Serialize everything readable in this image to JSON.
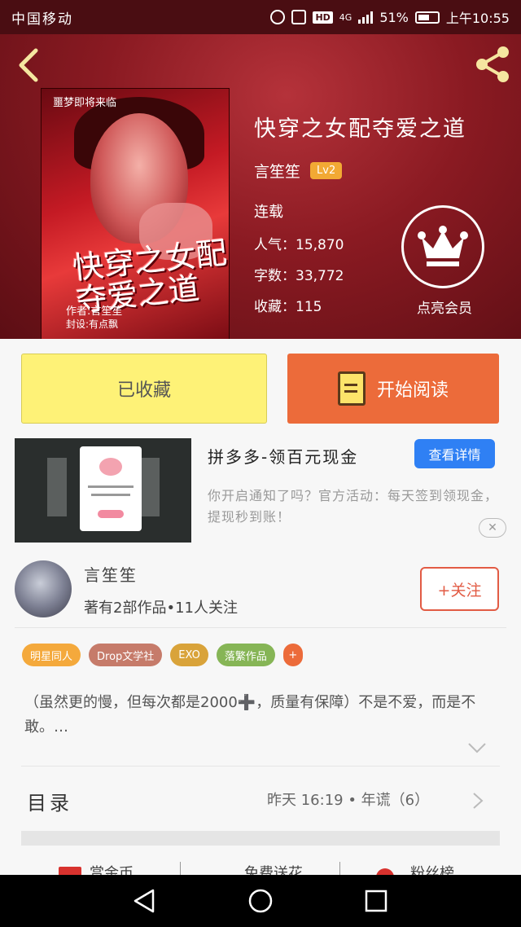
{
  "status_bar": {
    "carrier": "中国移动",
    "battery": "51%",
    "network": "4G",
    "hd": "HD",
    "time": "上午10:55"
  },
  "book": {
    "title": "快穿之女配夺爱之道",
    "author": "言笙笙",
    "level": "Lv2",
    "status": "连载",
    "popularity": "人气：15,870",
    "word_count": "字数：33,772",
    "favorites": "收藏：115",
    "vip_label": "点亮会员",
    "cover": {
      "top_text": "噩梦即将来临",
      "title_art": "快穿之女配夺爱之道",
      "author_line": "作者:言笙笙",
      "design_line": "封设:有点飘"
    }
  },
  "actions": {
    "collected": "已收藏",
    "start_reading": "开始阅读"
  },
  "ad": {
    "title": "拼多多-领百元现金",
    "detail_button": "查看详情",
    "description": "你开启通知了吗？官方活动：每天签到领现金，提现秒到账！",
    "close": "✕"
  },
  "author": {
    "name": "言笙笙",
    "stats": "著有2部作品•11人关注",
    "follow": "+关注"
  },
  "tags": [
    {
      "label": "明星同人",
      "color": "#f4a93c"
    },
    {
      "label": "Drop文学社",
      "color": "#c67b6a"
    },
    {
      "label": "EXO",
      "color": "#d9a33a"
    },
    {
      "label": "落繁作品",
      "color": "#86b556"
    },
    {
      "label": "+",
      "color": "#ec6b3a"
    }
  ],
  "description": "（虽然更的慢，但每次都是2000➕，质量有保障）不是不爱，而是不敢。…",
  "catalog": {
    "label": "目录",
    "info": "昨天 16:19 • 年谎（6）"
  },
  "bottom_tabs": [
    "赏金币",
    "免费送花",
    "粉丝榜"
  ],
  "colors": {
    "header_red": "#8a1a22",
    "collected_yellow": "#fef277",
    "read_orange": "#ec6b3a",
    "detail_blue": "#2f80f4",
    "follow_red": "#e25b44"
  }
}
